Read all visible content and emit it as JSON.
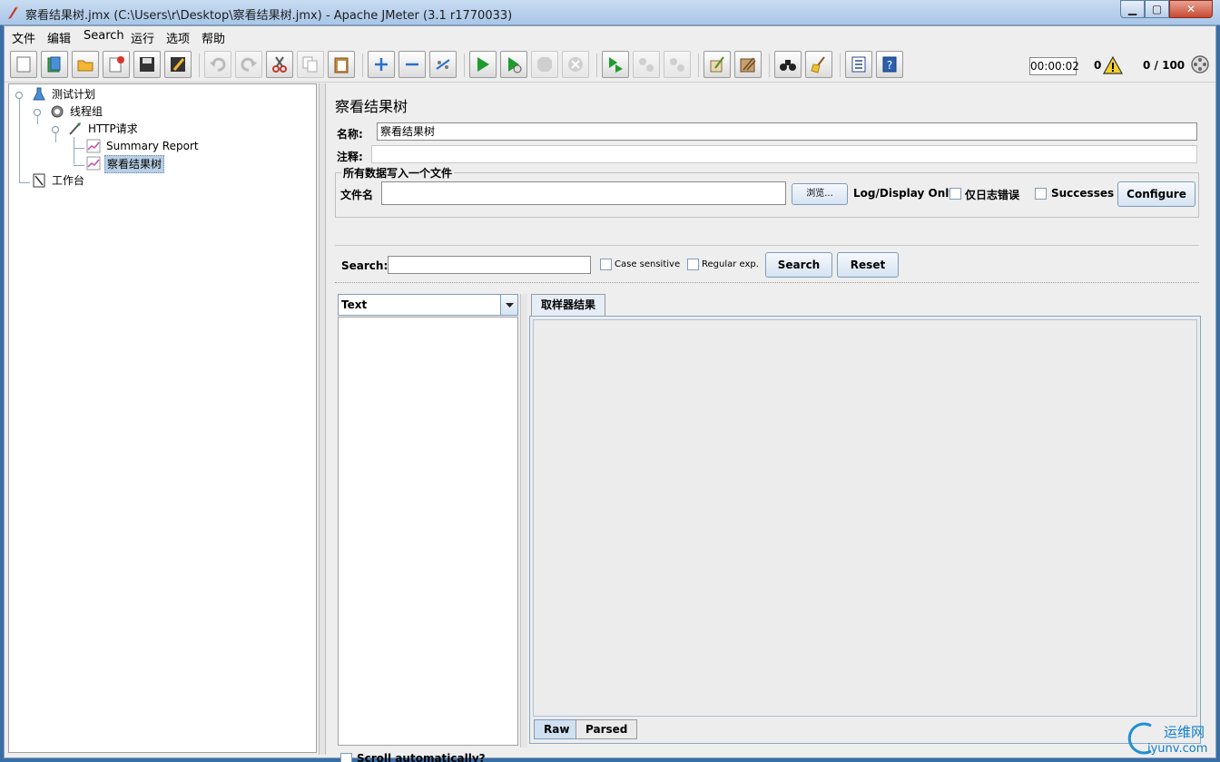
{
  "window": {
    "title": "察看结果树.jmx (C:\\Users\\r\\Desktop\\察看结果树.jmx) - Apache JMeter (3.1 r1770033)",
    "min_glyph": "▁",
    "max_glyph": "▢",
    "close_glyph": "✕"
  },
  "menu": {
    "items": [
      "文件",
      "编辑",
      "Search",
      "运行",
      "选项",
      "帮助"
    ]
  },
  "toolbar": {
    "buttons": [
      {
        "name": "new",
        "icon": "new-doc-icon"
      },
      {
        "name": "templates",
        "icon": "templates-icon"
      },
      {
        "name": "open",
        "icon": "open-folder-icon"
      },
      {
        "name": "close",
        "icon": "close-doc-icon"
      },
      {
        "name": "save",
        "icon": "save-icon"
      },
      {
        "name": "save-as",
        "icon": "save-as-icon"
      },
      {
        "name": "undo",
        "icon": "undo-icon"
      },
      {
        "name": "redo",
        "icon": "redo-icon"
      },
      {
        "name": "cut",
        "icon": "cut-icon"
      },
      {
        "name": "copy",
        "icon": "copy-icon"
      },
      {
        "name": "paste",
        "icon": "paste-icon"
      },
      {
        "name": "expand",
        "icon": "plus-icon"
      },
      {
        "name": "collapse",
        "icon": "minus-icon"
      },
      {
        "name": "toggle",
        "icon": "toggle-icon"
      },
      {
        "name": "start",
        "icon": "play-icon"
      },
      {
        "name": "start-no-pause",
        "icon": "play-no-pause-icon"
      },
      {
        "name": "stop",
        "icon": "stop-icon"
      },
      {
        "name": "shutdown",
        "icon": "shutdown-icon"
      },
      {
        "name": "remote-start",
        "icon": "remote-start-icon"
      },
      {
        "name": "remote-stop",
        "icon": "remote-stop-icon"
      },
      {
        "name": "remote-shutdown",
        "icon": "remote-shutdown-icon"
      },
      {
        "name": "clear",
        "icon": "clear-icon"
      },
      {
        "name": "clear-all",
        "icon": "clear-all-icon"
      },
      {
        "name": "search",
        "icon": "binoculars-icon"
      },
      {
        "name": "reset-search",
        "icon": "broom-icon"
      },
      {
        "name": "function-helper",
        "icon": "function-list-icon"
      },
      {
        "name": "help",
        "icon": "help-icon"
      }
    ],
    "elapsed": "00:00:02",
    "error_count": "0",
    "threads": "0 / 100"
  },
  "tree": {
    "nodes": [
      {
        "label": "测试计划",
        "icon": "test-plan-icon"
      },
      {
        "label": "线程组",
        "icon": "thread-group-icon"
      },
      {
        "label": "HTTP请求",
        "icon": "http-sampler-icon"
      },
      {
        "label": "Summary Report",
        "icon": "listener-icon"
      },
      {
        "label": "察看结果树",
        "icon": "listener-icon"
      },
      {
        "label": "工作台",
        "icon": "workbench-icon"
      }
    ]
  },
  "panel": {
    "title": "察看结果树",
    "name_label": "名称:",
    "name_value": "察看结果树",
    "comment_label": "注释:",
    "comment_value": "",
    "file_group_legend": "所有数据写入一个文件",
    "filename_label": "文件名",
    "filename_value": "",
    "browse_label": "浏览...",
    "log_display_label": "Log/Display Only:",
    "errors_only_label": "仅日志错误",
    "successes_label": "Successes",
    "configure_label": "Configure"
  },
  "search": {
    "label": "Search:",
    "value": "",
    "case_sensitive_label": "Case sensitive",
    "regex_label": "Regular exp.",
    "search_button": "Search",
    "reset_button": "Reset"
  },
  "results": {
    "renderer": "Text",
    "scroll_label": "Scroll automatically?",
    "tab_label": "取样器结果",
    "raw_tab": "Raw",
    "parsed_tab": "Parsed"
  },
  "watermark": {
    "text_cn": "运维网",
    "text_url": "iyunv.com"
  },
  "colors": {
    "window_frame": "#3a6ea5",
    "panel_bg": "#eeeeee",
    "selection": "#b8cfe5",
    "accent": "#0f7fc9"
  }
}
